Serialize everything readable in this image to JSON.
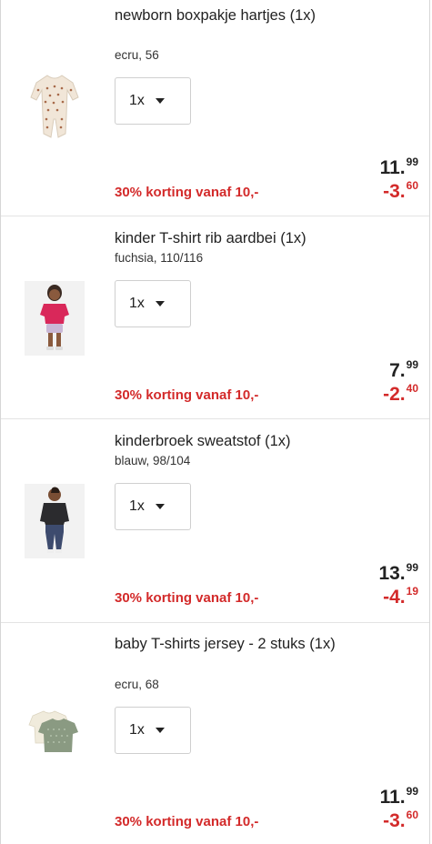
{
  "items": [
    {
      "title": "newborn boxpakje hartjes (1x)",
      "variant": "ecru, 56",
      "qty_label": "1x",
      "promo": "30% korting vanaf 10,-",
      "price_int": "11.",
      "price_dec": "99",
      "discount_int": "-3.",
      "discount_dec": "60",
      "image": "romper-hearts"
    },
    {
      "title": "kinder T-shirt rib aardbei (1x)",
      "variant": "fuchsia, 110/116",
      "qty_label": "1x",
      "promo": "30% korting vanaf 10,-",
      "price_int": "7.",
      "price_dec": "99",
      "discount_int": "-2.",
      "discount_dec": "40",
      "image": "girl-pink-tshirt"
    },
    {
      "title": "kinderbroek sweatstof (1x)",
      "variant": "blauw, 98/104",
      "qty_label": "1x",
      "promo": "30% korting vanaf 10,-",
      "price_int": "13.",
      "price_dec": "99",
      "discount_int": "-4.",
      "discount_dec": "19",
      "image": "boy-sweatpants"
    },
    {
      "title": "baby T-shirts jersey - 2 stuks (1x)",
      "variant": "ecru, 68",
      "qty_label": "1x",
      "promo": "30% korting vanaf 10,-",
      "price_int": "11.",
      "price_dec": "99",
      "discount_int": "-3.",
      "discount_dec": "60",
      "image": "baby-tshirts"
    }
  ]
}
